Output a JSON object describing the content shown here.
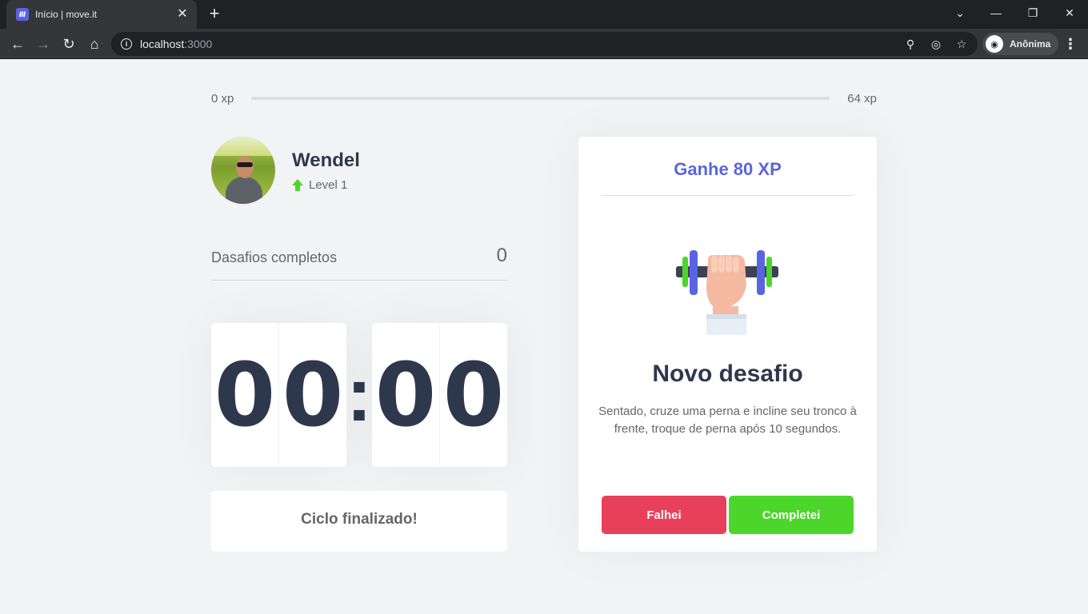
{
  "browser": {
    "tab_title": "Início | move.it",
    "tab_favicon": "Ⅲ",
    "new_tab": "+",
    "url_host": "localhost",
    "url_port": ":3000",
    "profile_label": "Anônima",
    "icons": {
      "back": "back-arrow-icon",
      "forward": "forward-arrow-icon",
      "reload": "reload-icon",
      "home": "home-icon",
      "zoom": "zoom-icon",
      "eye_off": "eye-off-icon",
      "star": "star-icon",
      "incognito": "incognito-icon",
      "menu": "kebab-menu-icon"
    }
  },
  "xp": {
    "min_label": "0 xp",
    "max_label": "64 xp",
    "progress_fraction": 0
  },
  "profile": {
    "name": "Wendel",
    "level": "Level 1"
  },
  "completed": {
    "label": "Dasafios completos",
    "count": "0"
  },
  "countdown": {
    "minute_left": "0",
    "minute_right": "0",
    "second_left": "0",
    "second_right": "0",
    "separator": ":"
  },
  "cycle_button": "Ciclo finalizado!",
  "challenge": {
    "header": "Ganhe 80 XP",
    "title": "Novo desafio",
    "description": "Sentado, cruze uma perna e incline seu tronco à frente, troque de perna após 10 segundos.",
    "fail_label": "Falhei",
    "complete_label": "Completei"
  },
  "colors": {
    "accent": "#5965e0",
    "success": "#4cd62b",
    "danger": "#e83f5b",
    "title": "#2e384d",
    "background": "#f2f3f5"
  }
}
